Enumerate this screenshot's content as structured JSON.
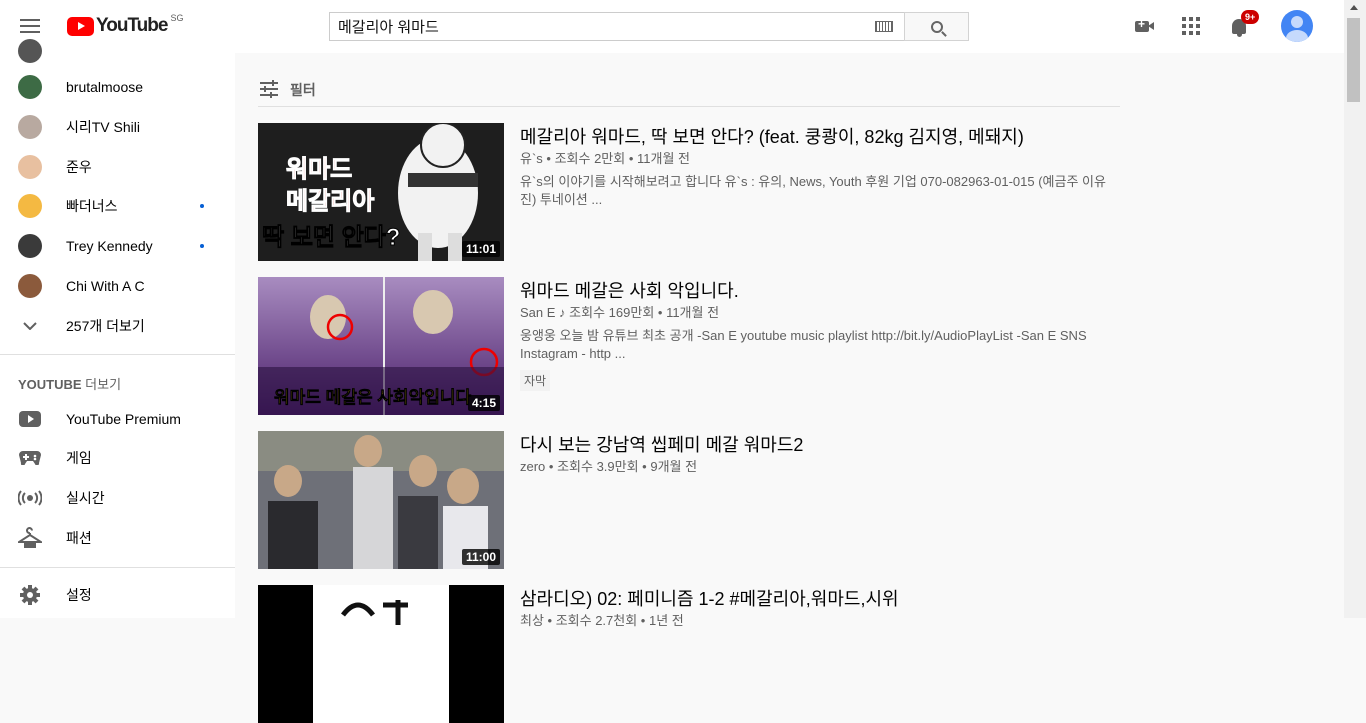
{
  "header": {
    "logo_text": "YouTube",
    "logo_region": "SG",
    "search_value": "메갈리아 워마드",
    "notification_count": "9+"
  },
  "sidebar": {
    "subscriptions": [
      {
        "label": "brutalmoose",
        "dot": false,
        "color": "#3d6b45"
      },
      {
        "label": "시리TV Shili",
        "dot": false,
        "color": "#b8a9a0"
      },
      {
        "label": "준우",
        "dot": false,
        "color": "#e8c0a0"
      },
      {
        "label": "빠더너스",
        "dot": true,
        "color": "#f4b942"
      },
      {
        "label": "Trey Kennedy",
        "dot": true,
        "color": "#3a3a3a"
      },
      {
        "label": "Chi With A C",
        "dot": false,
        "color": "#8b5a3c"
      }
    ],
    "show_more": "257개 더보기",
    "section_title_bold": "YOUTUBE",
    "section_title_rest": " 더보기",
    "more_items": [
      {
        "label": "YouTube Premium",
        "icon": "youtube-premium-icon"
      },
      {
        "label": "게임",
        "icon": "gaming-icon"
      },
      {
        "label": "실시간",
        "icon": "live-icon"
      },
      {
        "label": "패션",
        "icon": "hanger-icon"
      }
    ],
    "settings": "설정"
  },
  "main": {
    "filter_label": "필터",
    "videos": [
      {
        "title": "메갈리아 워마드, 딱 보면 안다? (feat. 쿵쾅이, 82kg 김지영, 메돼지)",
        "channel": "유`s",
        "views": "조회수 2만회",
        "age": "11개월 전",
        "description": "유`s의 이야기를 시작해보려고 합니다 유`s : 유의, News, Youth 후원 기업 070-082963-01-015 (예금주 이유진) 투네이션 ...",
        "duration": "11:01",
        "thumb_text": [
          "워마드",
          "메갈리아",
          "딱 보면 안다?"
        ],
        "thumb_bg": "#1a1a1a",
        "tag": ""
      },
      {
        "title": "워마드 메갈은 사회 악입니다.",
        "channel": "San E",
        "verified_music": "♪",
        "views": "조회수 169만회",
        "age": "11개월 전",
        "description": "웅앵웅 오늘 밤 유튜브 최초 공개 -San E youtube music playlist http://bit.ly/AudioPlayList -San E SNS Instagram - http ...",
        "duration": "4:15",
        "thumb_text": [
          "워마드 메갈은 사회악입니다"
        ],
        "thumb_bg": "#6b3a8a",
        "tag": "자막"
      },
      {
        "title": "다시 보는 강남역 씹페미 메갈 워마드2",
        "channel": "zero",
        "views": "조회수 3.9만회",
        "age": "9개월 전",
        "description": "",
        "duration": "11:00",
        "thumb_bg": "#5a5a62",
        "tag": ""
      },
      {
        "title": "삼라디오) 02: 페미니즘 1-2 #메갈리아,워마드,시위",
        "channel": "최상",
        "views": "조회수 2.7천회",
        "age": "1년 전",
        "description": "",
        "duration": "",
        "thumb_bg": "#000000",
        "tag": ""
      }
    ]
  }
}
